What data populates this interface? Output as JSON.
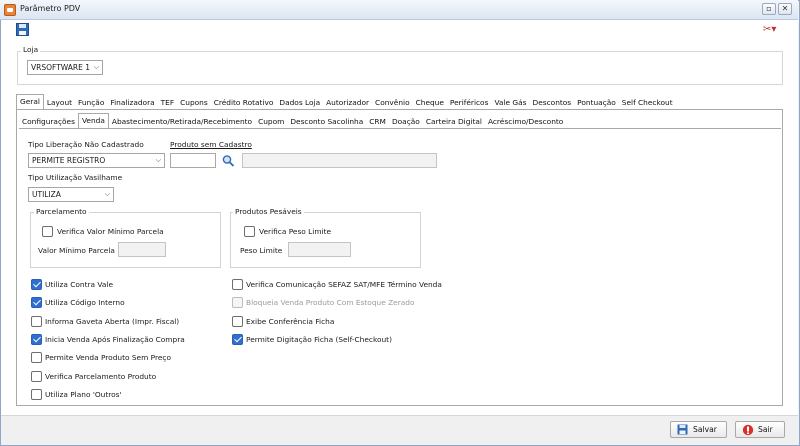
{
  "window": {
    "title": "Parâmetro PDV"
  },
  "loja": {
    "label": "Loja",
    "selected": "VRSOFTWARE 1"
  },
  "tabs_main": [
    "Geral",
    "Layout",
    "Função",
    "Finalizadora",
    "TEF",
    "Cupons",
    "Crédito Rotativo",
    "Dados Loja",
    "Autorizador",
    "Convênio",
    "Cheque",
    "Periféricos",
    "Vale Gás",
    "Descontos",
    "Pontuação",
    "Self Checkout"
  ],
  "tabs_sub": [
    "Configurações",
    "Venda",
    "Abastecimento/Retirada/Recebimento",
    "Cupom",
    "Desconto Sacolinha",
    "CRM",
    "Doação",
    "Carteira Digital",
    "Acréscimo/Desconto"
  ],
  "form": {
    "tipo_liberacao_label": "Tipo Liberação Não Cadastrado",
    "tipo_liberacao_value": "PERMITE REGISTRO",
    "produto_sem_cadastro_label": "Produto sem Cadastro",
    "tipo_vasilhame_label": "Tipo Utilização Vasilhame",
    "tipo_vasilhame_value": "UTILIZA",
    "parcelamento_title": "Parcelamento",
    "verifica_valor_minimo_label": "Verifica Valor Mínimo Parcela",
    "valor_minimo_label": "Valor Mínimo Parcela",
    "produtos_pesaveis_title": "Produtos Pesáveis",
    "verifica_peso_label": "Verifica Peso Limite",
    "peso_limite_label": "Peso Limite"
  },
  "checks_left": [
    {
      "label": "Utiliza Contra Vale",
      "checked": true
    },
    {
      "label": "Utiliza Código Interno",
      "checked": true
    },
    {
      "label": "Informa Gaveta Aberta (Impr. Fiscal)",
      "checked": false
    },
    {
      "label": "Inicia Venda Após Finalização Compra",
      "checked": true
    },
    {
      "label": "Permite Venda Produto Sem Preço",
      "checked": false
    },
    {
      "label": "Verifica Parcelamento Produto",
      "checked": false
    },
    {
      "label": "Utiliza Plano 'Outros'",
      "checked": false
    }
  ],
  "checks_right": [
    {
      "label": "Verifica Comunicação SEFAZ SAT/MFE Término Venda",
      "checked": false
    },
    {
      "label": "Bloqueia Venda Produto Com Estoque Zerado",
      "checked": false,
      "disabled": true
    },
    {
      "label": "Exibe Conferência Ficha",
      "checked": false
    },
    {
      "label": "Permite Digitação Ficha (Self-Checkout)",
      "checked": true
    }
  ],
  "footer": {
    "save_label": "Salvar",
    "exit_label": "Sair"
  },
  "icons": [
    "app-icon",
    "floppy-disk-icon",
    "tools-icon",
    "magnifier-icon",
    "minimize-icon",
    "close-icon"
  ]
}
